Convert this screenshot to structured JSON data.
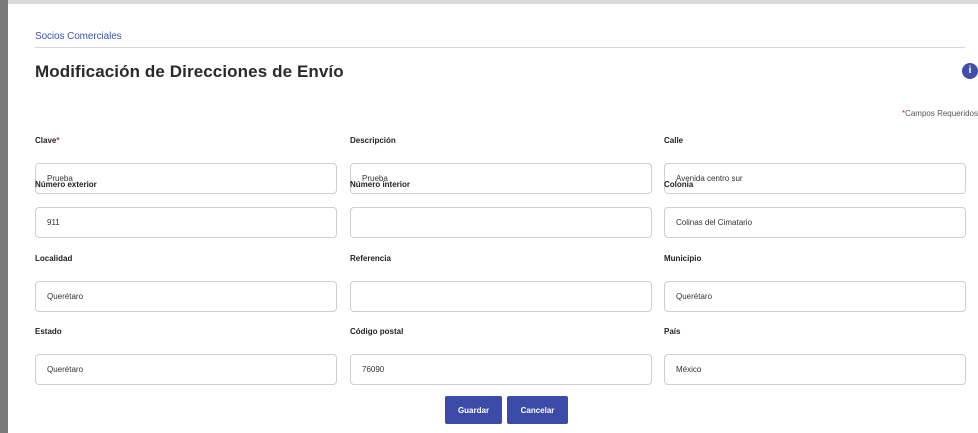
{
  "breadcrumb": {
    "link": "Socios Comerciales"
  },
  "title": "Modificación de Direcciones de Envío",
  "icons": {
    "info": "info-icon"
  },
  "info_glyph": "i",
  "required_note": {
    "star": "*",
    "text": "Campos Requeridos"
  },
  "fields": {
    "clave": {
      "label": "Clave",
      "required": "*",
      "value": "Prueba"
    },
    "descripcion": {
      "label": "Descripción",
      "value": "Prueba"
    },
    "calle": {
      "label": "Calle",
      "value": "Avenida centro sur"
    },
    "numero_exterior": {
      "label": "Número exterior",
      "value": "911"
    },
    "numero_interior": {
      "label": "Número interior",
      "value": ""
    },
    "colonia": {
      "label": "Colonia",
      "value": "Colinas del Cimatario"
    },
    "localidad": {
      "label": "Localidad",
      "value": "Querétaro"
    },
    "referencia": {
      "label": "Referencia",
      "value": ""
    },
    "municipio": {
      "label": "Municipio",
      "value": "Querétaro"
    },
    "estado": {
      "label": "Estado",
      "value": "Querétaro"
    },
    "codigo_postal": {
      "label": "Código postal",
      "value": "76090"
    },
    "pais": {
      "label": "País",
      "value": "México"
    }
  },
  "buttons": {
    "save": "Guardar",
    "cancel": "Cancelar"
  },
  "colors": {
    "primary": "#3c4ba8",
    "link": "#3a55b0",
    "required": "#d6201c"
  }
}
